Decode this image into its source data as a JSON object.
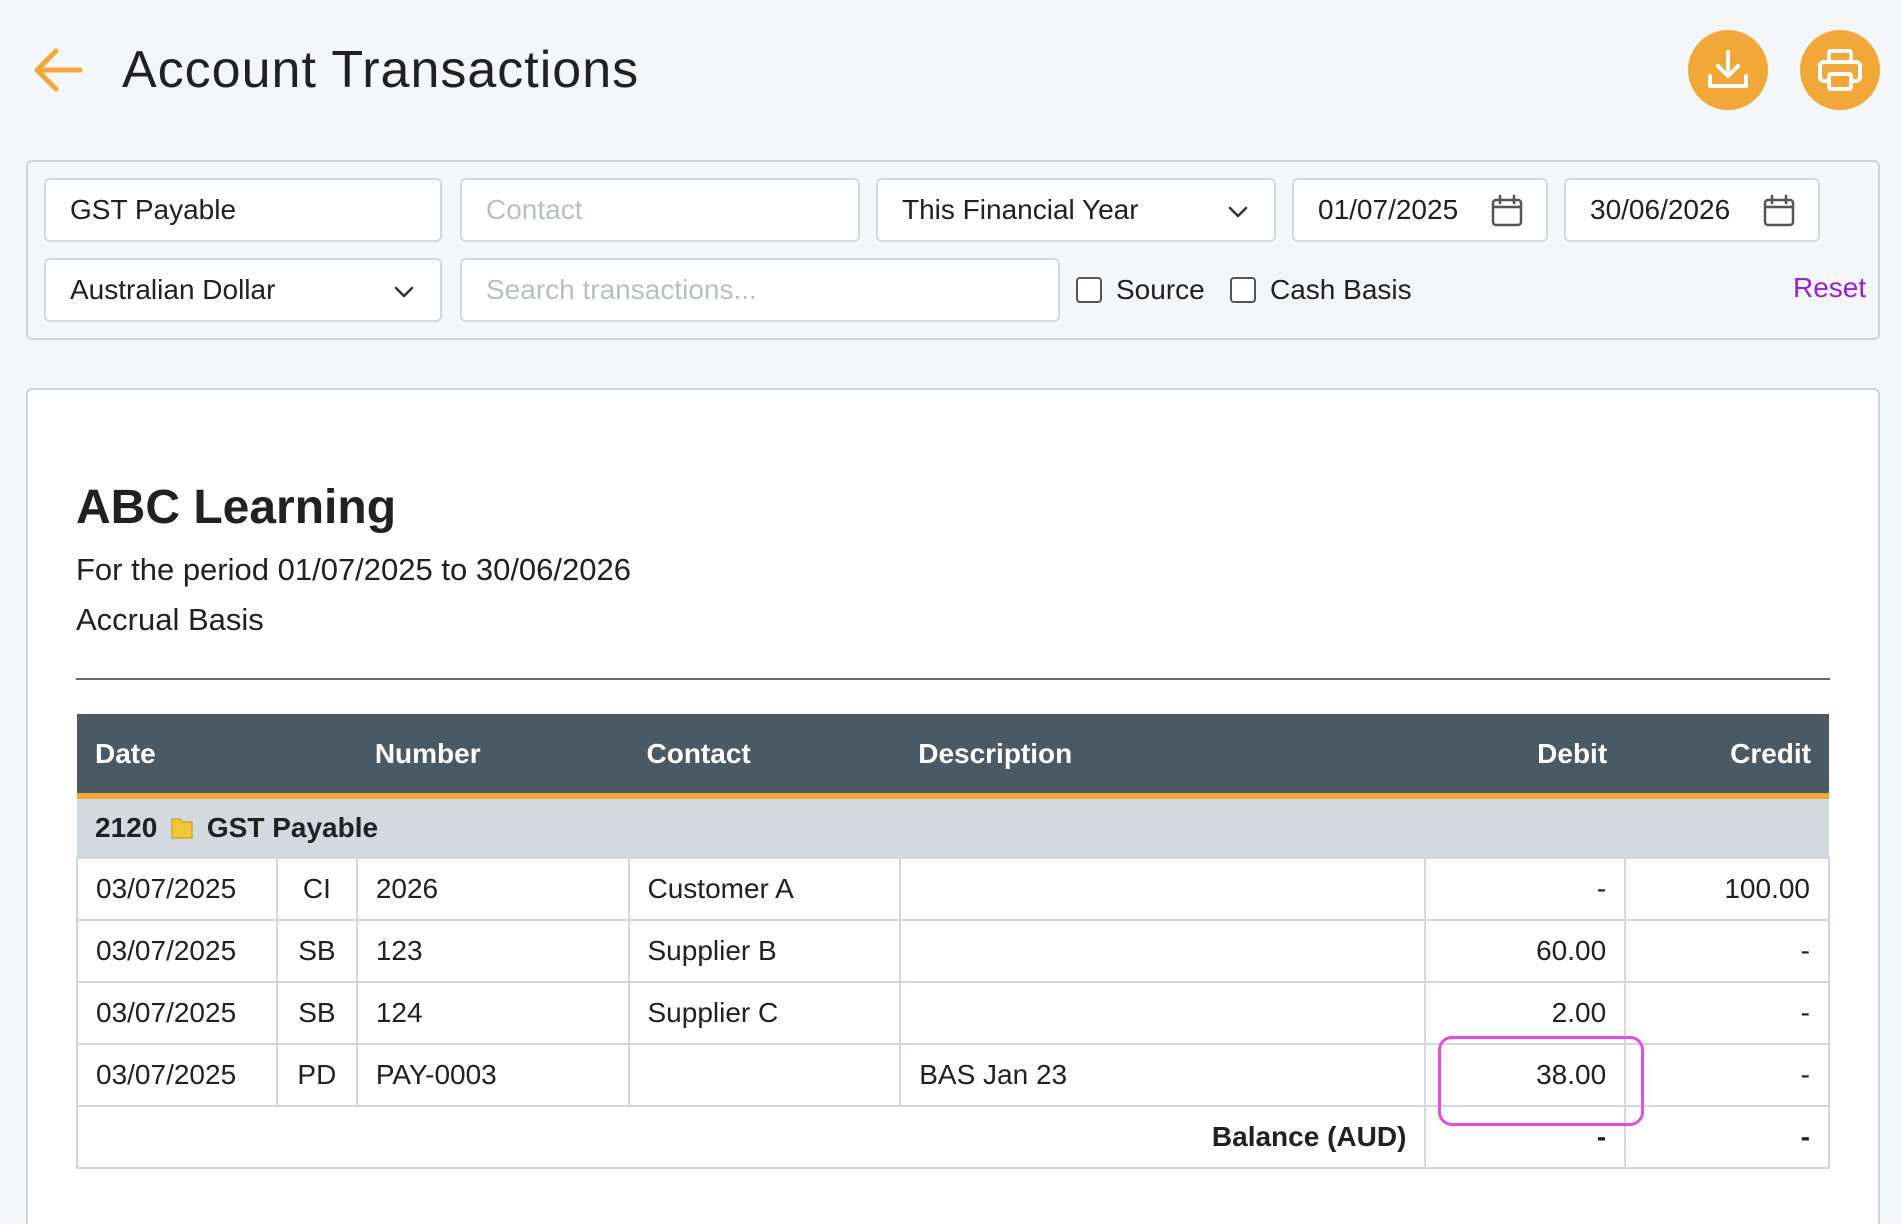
{
  "header": {
    "title": "Account Transactions",
    "icons": {
      "back": "arrow-left-icon",
      "download": "download-icon",
      "print": "printer-icon"
    },
    "accent_color": "#f2a838"
  },
  "filters": {
    "account": "GST Payable",
    "contact_placeholder": "Contact",
    "period": "This Financial Year",
    "date_from": "01/07/2025",
    "date_to": "30/06/2026",
    "currency": "Australian Dollar",
    "search_placeholder": "Search transactions...",
    "source_label": "Source",
    "cash_basis_label": "Cash Basis",
    "reset_label": "Reset"
  },
  "report": {
    "organisation": "ABC Learning",
    "period_text": "For the period 01/07/2025 to 30/06/2026",
    "basis": "Accrual Basis",
    "columns": {
      "date": "Date",
      "number": "Number",
      "contact": "Contact",
      "description": "Description",
      "debit": "Debit",
      "credit": "Credit"
    },
    "account_group": {
      "code": "2120",
      "name": "GST Payable",
      "icon": "folder-icon"
    },
    "rows": [
      {
        "date": "03/07/2025",
        "type": "CI",
        "number": "2026",
        "contact": "Customer A",
        "description": "",
        "debit": "-",
        "credit": "100.00"
      },
      {
        "date": "03/07/2025",
        "type": "SB",
        "number": "123",
        "contact": "Supplier B",
        "description": "",
        "debit": "60.00",
        "credit": "-"
      },
      {
        "date": "03/07/2025",
        "type": "SB",
        "number": "124",
        "contact": "Supplier C",
        "description": "",
        "debit": "2.00",
        "credit": "-"
      },
      {
        "date": "03/07/2025",
        "type": "PD",
        "number": "PAY-0003",
        "contact": "",
        "description": "BAS Jan 23",
        "debit": "38.00",
        "credit": "-"
      }
    ],
    "balance": {
      "label": "Balance (AUD)",
      "debit": "-",
      "credit": "-"
    }
  }
}
